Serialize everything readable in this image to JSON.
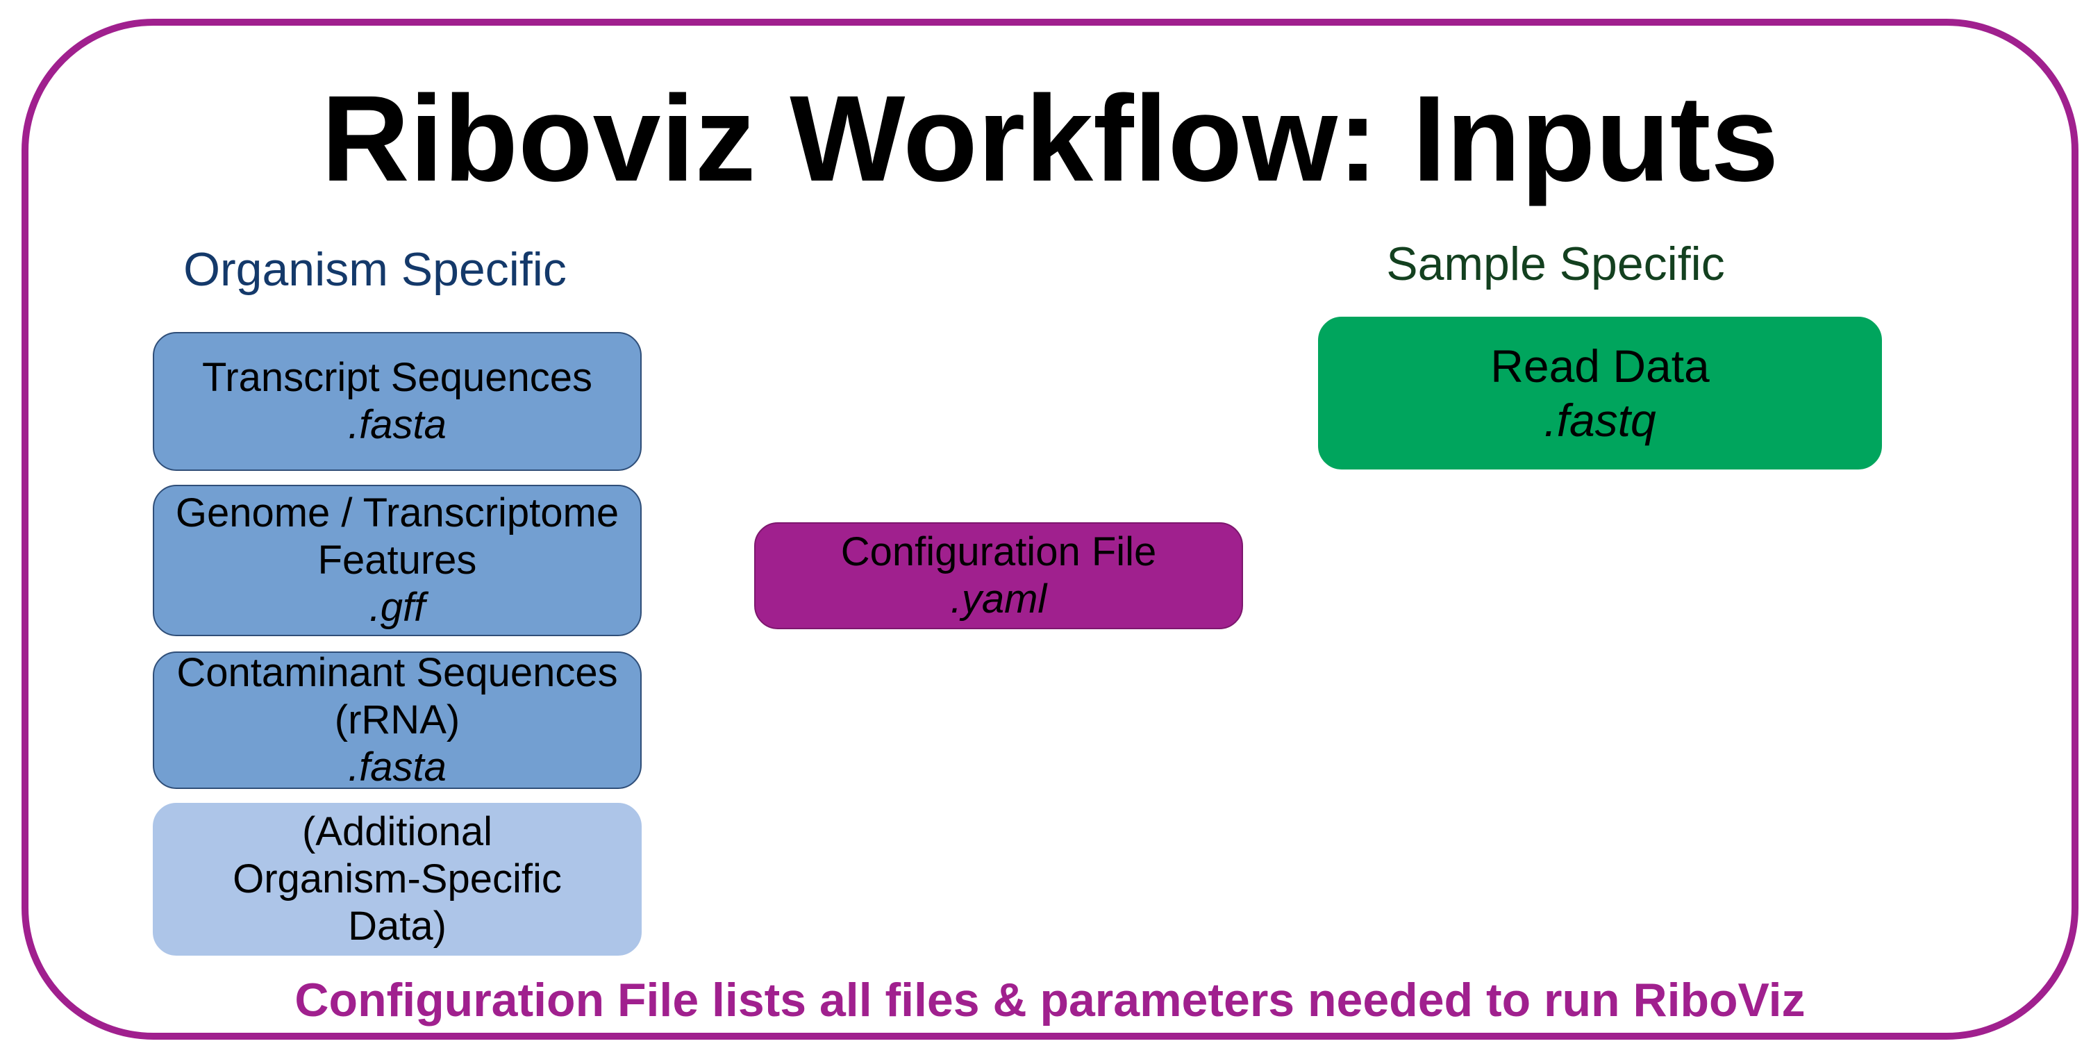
{
  "title": "Riboviz Workflow: Inputs",
  "colors": {
    "frame": "#a0208e",
    "organism_box": "#739fd1",
    "additional_box": "#adc5e8",
    "config_box": "#a0208e",
    "sample_box": "#00a55d",
    "organism_heading": "#14396a",
    "sample_heading": "#13401f",
    "footer": "#a0208e"
  },
  "organism": {
    "heading": "Organism Specific",
    "boxes": [
      {
        "lines": [
          "Transcript Sequences"
        ],
        "ext": ".fasta"
      },
      {
        "lines": [
          "Genome / Transcriptome",
          "Features"
        ],
        "ext": ".gff"
      },
      {
        "lines": [
          "Contaminant Sequences",
          "(rRNA)"
        ],
        "ext": ".fasta"
      },
      {
        "lines": [
          "(Additional",
          "Organism-Specific",
          "Data)"
        ],
        "ext": ""
      }
    ]
  },
  "config": {
    "label": "Configuration File",
    "ext": ".yaml"
  },
  "sample": {
    "heading": "Sample Specific",
    "box": {
      "label": "Read Data",
      "ext": ".fastq"
    }
  },
  "footer": "Configuration File lists all files & parameters needed to run RiboViz"
}
